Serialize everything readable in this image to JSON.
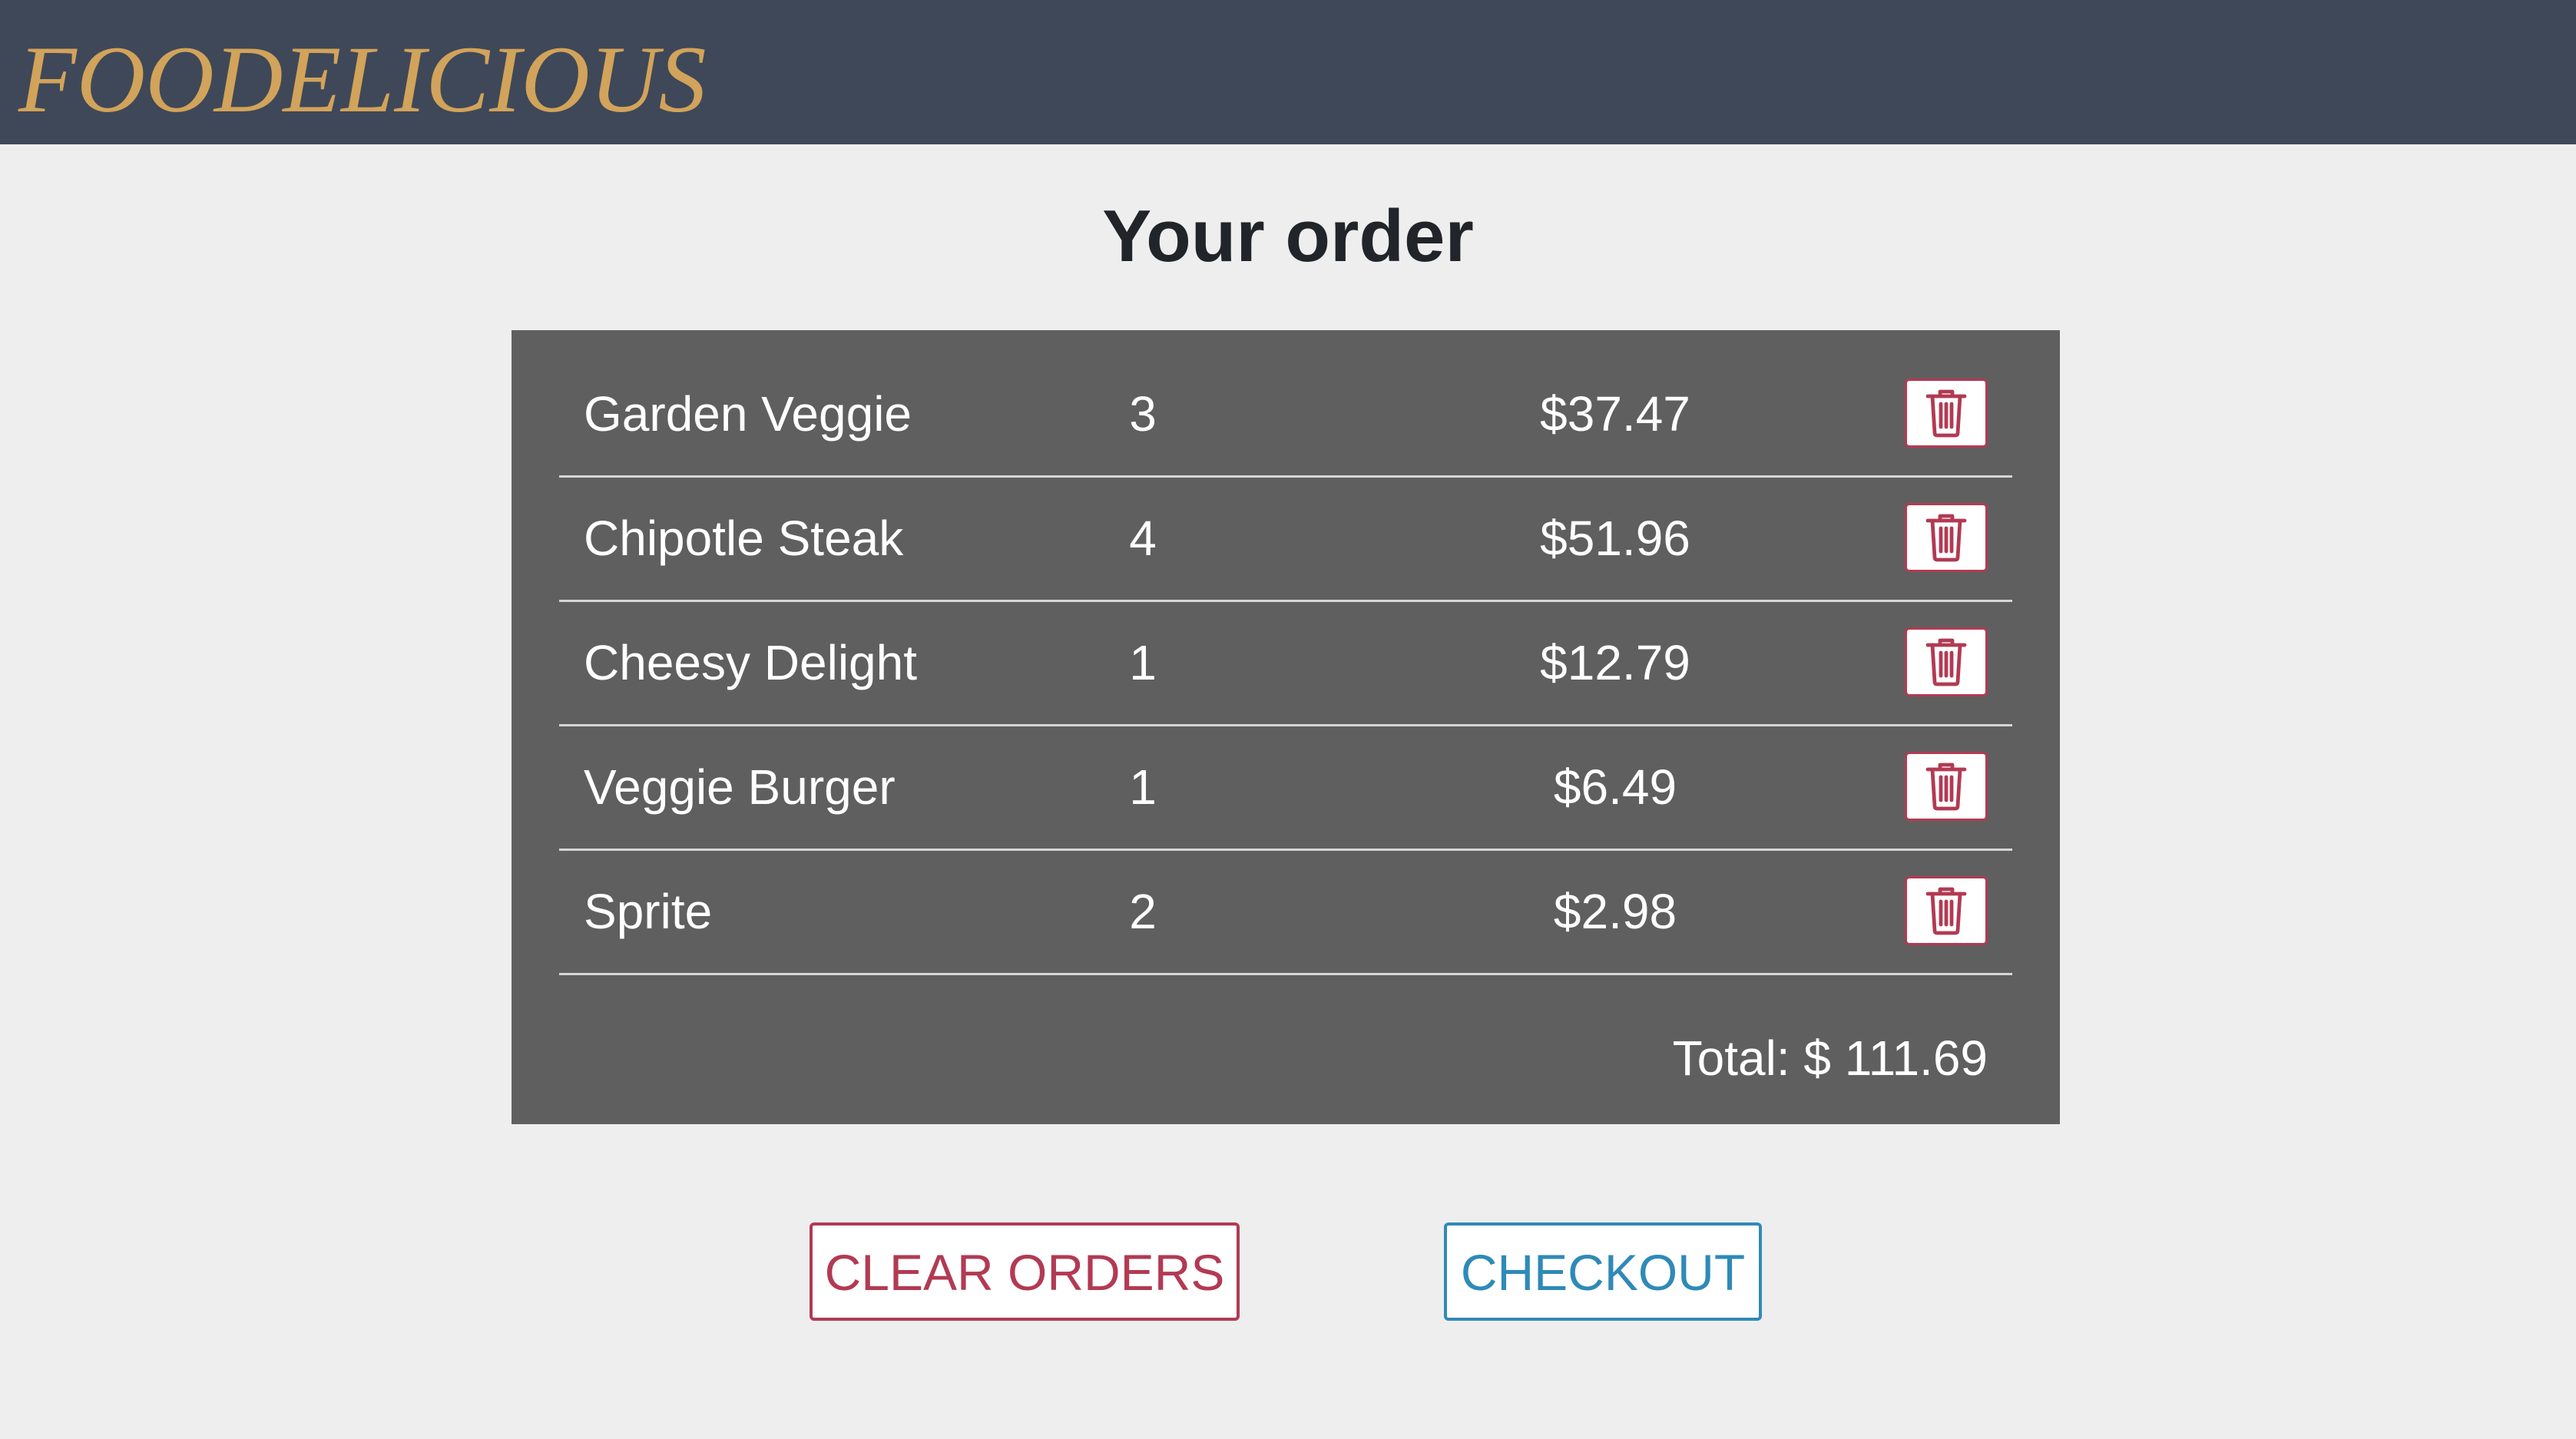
{
  "brand": {
    "name": "FOODELICIOUS",
    "color": "#d2a35a",
    "navbar_color": "#3f4858"
  },
  "page": {
    "title": "Your order"
  },
  "order": {
    "items": [
      {
        "name": "Garden Veggie",
        "quantity": "3",
        "price": "$37.47",
        "delete_icon": "trash-icon"
      },
      {
        "name": "Chipotle Steak",
        "quantity": "4",
        "price": "$51.96",
        "delete_icon": "trash-icon"
      },
      {
        "name": "Cheesy Delight",
        "quantity": "1",
        "price": "$12.79",
        "delete_icon": "trash-icon"
      },
      {
        "name": "Veggie Burger",
        "quantity": "1",
        "price": "$6.49",
        "delete_icon": "trash-icon"
      },
      {
        "name": "Sprite",
        "quantity": "2",
        "price": "$2.98",
        "delete_icon": "trash-icon"
      }
    ],
    "total_label": "Total: $ 111.69",
    "panel_color": "#5f5f5f"
  },
  "actions": {
    "clear_label": "CLEAR ORDERS",
    "checkout_label": "CHECKOUT",
    "danger_color": "#b23a53",
    "primary_color": "#2f8ab7"
  }
}
